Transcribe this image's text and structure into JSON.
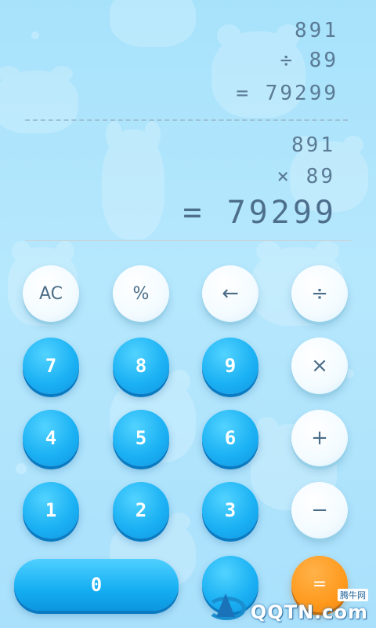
{
  "display": {
    "history_operand1": "891",
    "history_operand2": "÷ 89",
    "history_result": "= 79299",
    "current_operand1": "891",
    "current_operand2": "× 89",
    "current_result": "= 79299"
  },
  "keypad": {
    "ac": "AC",
    "percent": "%",
    "backspace": "←",
    "divide": "÷",
    "seven": "7",
    "eight": "8",
    "nine": "9",
    "multiply": "×",
    "four": "4",
    "five": "5",
    "six": "6",
    "plus": "+",
    "one": "1",
    "two": "2",
    "three": "3",
    "minus": "−",
    "zero": "0",
    "equals": "="
  },
  "watermark": {
    "chinese": "腾牛网",
    "english": "QQTN.com"
  },
  "colors": {
    "background": "#b6e8fd",
    "number_key": "#1cb2f4",
    "function_key": "#f3fbff",
    "equals_key": "#ff9a1e",
    "display_text": "#5a7a95"
  }
}
